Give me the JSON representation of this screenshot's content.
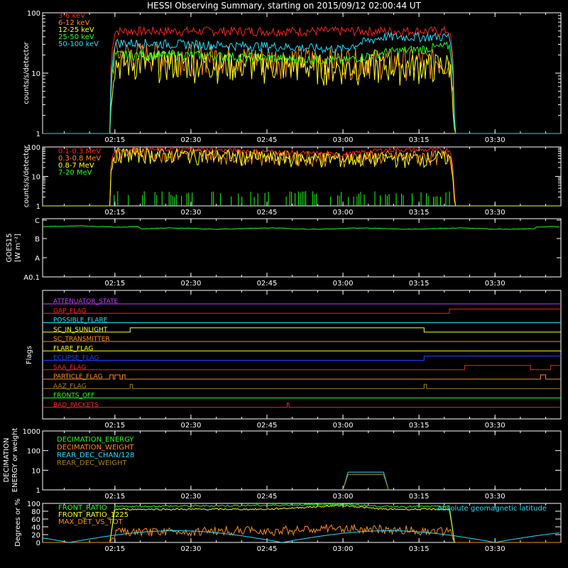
{
  "title": "HESSI Observing Summary, starting on 2015/09/12 02:00:44 UT",
  "colors": {
    "red": "#ff2020",
    "orange": "#ff8c1a",
    "yellow": "#ffff20",
    "green": "#20ff20",
    "cyan": "#20e0ff",
    "magenta": "#c040ff",
    "blue": "#2040ff",
    "olive": "#a08020",
    "brown": "#c06020",
    "white": "#ffffff"
  },
  "time_ticks": [
    "02:15",
    "02:30",
    "02:45",
    "03:00",
    "03:15",
    "03:30"
  ],
  "chart_data": [
    {
      "type": "line",
      "name": "lightcurves",
      "ylabel": "counts/s/detector",
      "yscale": "log",
      "ylim": [
        1,
        100
      ],
      "ytick_labels": [
        "1",
        "10",
        "100"
      ],
      "xlim": [
        "02:00:44",
        "03:43"
      ],
      "series": [
        {
          "name": "3-6 keV",
          "color": "#ff2020",
          "x": [
            "02:14",
            "02:15",
            "02:30",
            "02:45",
            "03:00",
            "03:08",
            "03:15",
            "03:21",
            "03:22",
            "03:43"
          ],
          "y": [
            1,
            50,
            50,
            50,
            50,
            50,
            50,
            50,
            1,
            1
          ]
        },
        {
          "name": "6-12 keV",
          "color": "#ff8c1a",
          "x": [
            "02:14",
            "02:15",
            "02:30",
            "02:45",
            "03:00",
            "03:21",
            "03:22",
            "03:43"
          ],
          "y": [
            1,
            22,
            20,
            18,
            17,
            16,
            1,
            1
          ]
        },
        {
          "name": "12-25 keV",
          "color": "#ffff20",
          "x": [
            "02:14",
            "02:15",
            "02:30",
            "02:45",
            "03:00",
            "03:21",
            "03:22",
            "03:43"
          ],
          "y": [
            1,
            15,
            15,
            14,
            13,
            14,
            1,
            1
          ]
        },
        {
          "name": "25-50 keV",
          "color": "#20ff20",
          "x": [
            "02:14",
            "02:15",
            "02:30",
            "02:45",
            "03:00",
            "03:08",
            "03:15",
            "03:21",
            "03:22",
            "03:43"
          ],
          "y": [
            1,
            20,
            20,
            18,
            16,
            22,
            25,
            28,
            1,
            1
          ]
        },
        {
          "name": "50-100 keV",
          "color": "#20e0ff",
          "x": [
            "02:14",
            "02:15",
            "02:30",
            "02:45",
            "03:00",
            "03:08",
            "03:15",
            "03:21",
            "03:22",
            "03:43"
          ],
          "y": [
            1,
            32,
            30,
            28,
            25,
            40,
            40,
            40,
            1,
            1
          ]
        }
      ]
    },
    {
      "type": "line",
      "name": "high-energy",
      "ylabel": "counts/s/detector",
      "yscale": "log",
      "ylim": [
        1,
        100
      ],
      "ytick_labels": [
        "1",
        "10",
        "100"
      ],
      "series": [
        {
          "name": "0.1-0.3 MeV",
          "color": "#ff2020",
          "x": [
            "02:14",
            "02:15",
            "02:30",
            "02:45",
            "03:00",
            "03:08",
            "03:15",
            "03:21",
            "03:22",
            "03:43"
          ],
          "y": [
            1,
            80,
            85,
            70,
            55,
            80,
            80,
            80,
            1,
            1
          ]
        },
        {
          "name": "0.3-0.8 MeV",
          "color": "#ff8c1a",
          "x": [
            "02:14",
            "02:15",
            "02:30",
            "02:45",
            "03:00",
            "03:21",
            "03:22",
            "03:43"
          ],
          "y": [
            1,
            65,
            60,
            50,
            45,
            50,
            1,
            1
          ]
        },
        {
          "name": "0.8-7 MeV",
          "color": "#ffff20",
          "x": [
            "02:14",
            "02:15",
            "02:30",
            "02:45",
            "03:00",
            "03:21",
            "03:22",
            "03:43"
          ],
          "y": [
            1,
            60,
            55,
            45,
            40,
            45,
            1,
            1
          ]
        },
        {
          "name": "7-20 MeV",
          "color": "#20ff20",
          "x": [
            "02:15",
            "03:21"
          ],
          "y": [
            1,
            1
          ]
        }
      ]
    },
    {
      "type": "line",
      "name": "goes",
      "ylabel": "GOES15",
      "ylabel2": "[W m⁻²]",
      "yscale": "log",
      "ytick_labels": [
        "A0.1",
        "A",
        "B",
        "C"
      ],
      "series": [
        {
          "name": "GOES15",
          "color": "#20ff20",
          "x": [
            "02:00:44",
            "02:15",
            "02:30",
            "02:45",
            "03:00",
            "03:15",
            "03:30",
            "03:43"
          ],
          "y": [
            "B7",
            "B7",
            "B6",
            "B6",
            "B6",
            "B6",
            "B6",
            "B8"
          ]
        }
      ]
    },
    {
      "type": "line",
      "name": "flags",
      "ylabel": "Flags",
      "flags": [
        {
          "label": "ATTENUATOR_STATE",
          "color": "#c040ff"
        },
        {
          "label": "GAP_FLAG",
          "color": "#ff2020"
        },
        {
          "label": "POSSIBLE_FLARE",
          "color": "#20e0ff"
        },
        {
          "label": "SC_IN_SUNLIGHT",
          "color": "#ffff20"
        },
        {
          "label": "SC_TRANSMITTER",
          "color": "#ff8c1a"
        },
        {
          "label": "FLARE_FLAG",
          "color": "#ffff20"
        },
        {
          "label": "ECLIPSE_FLAG",
          "color": "#2040ff"
        },
        {
          "label": "SAA_FLAG",
          "color": "#ff2020"
        },
        {
          "label": "PARTICLE_FLAG",
          "color": "#ff8c1a"
        },
        {
          "label": "AAZ_FLAG",
          "color": "#a08020"
        },
        {
          "label": "FRONTS_OFF",
          "color": "#20ff20"
        },
        {
          "label": "BAD_PACKETS",
          "color": "#ff2020"
        }
      ]
    },
    {
      "type": "line",
      "name": "decimation",
      "ylabel": "DECIMATION",
      "ylabel2": "ENERGY or weight",
      "yscale": "log",
      "ylim": [
        1,
        1000
      ],
      "ytick_labels": [
        "1",
        "10",
        "100",
        "1000"
      ],
      "series": [
        {
          "name": "DECIMATION_ENERGY",
          "color": "#20ff20"
        },
        {
          "name": "DECIMATION_WEIGHT",
          "color": "#ff8c1a"
        },
        {
          "name": "REAR_DEC_CHAN/128",
          "color": "#20e0ff",
          "x": [
            "03:00",
            "03:01",
            "03:08",
            "03:09"
          ],
          "y": [
            0,
            8,
            8,
            0
          ]
        },
        {
          "name": "REAR_DEC_WEIGHT",
          "color": "#a08020",
          "x": [
            "03:00",
            "03:01",
            "03:08",
            "03:09"
          ],
          "y": [
            0,
            6,
            6,
            0
          ]
        }
      ]
    },
    {
      "type": "line",
      "name": "ratios",
      "ylabel": "Degrees or %",
      "ylim": [
        0,
        100
      ],
      "ytick_labels": [
        "0",
        "20",
        "40",
        "60",
        "80",
        "100"
      ],
      "series": [
        {
          "name": "FRONT_RATIO",
          "color": "#20ff20",
          "x": [
            "02:14",
            "02:15",
            "02:45",
            "03:00",
            "03:08",
            "03:21",
            "03:22"
          ],
          "y": [
            0,
            92,
            95,
            98,
            92,
            92,
            0
          ]
        },
        {
          "name": "FRONT_RATIO_1225",
          "color": "#ffff20",
          "x": [
            "02:14",
            "02:15",
            "02:45",
            "03:00",
            "03:08",
            "03:21",
            "03:22"
          ],
          "y": [
            0,
            85,
            85,
            95,
            85,
            85,
            0
          ]
        },
        {
          "name": "MAX_DET_VS_TOT",
          "color": "#ff8c1a",
          "x": [
            "02:14",
            "02:15",
            "02:30",
            "02:45",
            "03:00",
            "03:15",
            "03:21",
            "03:22"
          ],
          "y": [
            0,
            25,
            28,
            30,
            35,
            30,
            28,
            0
          ]
        },
        {
          "name": "Absolute geomagnetic latitude",
          "color": "#20e0ff",
          "x": [
            "02:00:44",
            "02:22",
            "02:48",
            "03:04",
            "03:30",
            "03:43"
          ],
          "y": [
            10,
            30,
            0,
            30,
            0,
            15
          ]
        }
      ]
    }
  ]
}
